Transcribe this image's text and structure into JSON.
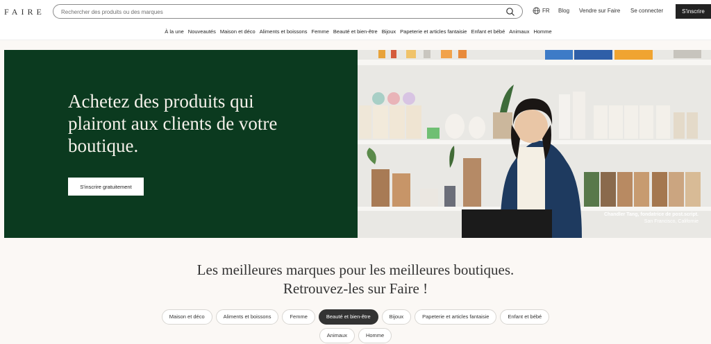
{
  "header": {
    "logo": "FAIRE",
    "search_placeholder": "Rechercher des produits ou des marques",
    "lang": "FR",
    "blog": "Blog",
    "sell": "Vendre sur Faire",
    "login": "Se connecter",
    "signup": "S'inscrire"
  },
  "categories": [
    "À la une",
    "Nouveautés",
    "Maison et déco",
    "Aliments et boissons",
    "Femme",
    "Beauté et bien-être",
    "Bijoux",
    "Papeterie et articles fantaisie",
    "Enfant et bébé",
    "Animaux",
    "Homme"
  ],
  "hero": {
    "title": "Achetez des produits qui plairont aux clients de votre boutique.",
    "cta": "S'inscrire gratuitement",
    "caption_name": "Chandler Tang, fondatrice de post.script.",
    "caption_location": "San Francisco, Californie",
    "bg_color": "#0b3a1f"
  },
  "brands": {
    "line1": "Les meilleures marques pour les meilleures boutiques.",
    "line2": "Retrouvez-les sur Faire !",
    "pills": [
      "Maison et déco",
      "Aliments et boissons",
      "Femme",
      "Beauté et bien-être",
      "Bijoux",
      "Papeterie et articles fantaisie",
      "Enfant et bébé",
      "Animaux",
      "Homme"
    ],
    "active_pill": "Beauté et bien-être"
  }
}
